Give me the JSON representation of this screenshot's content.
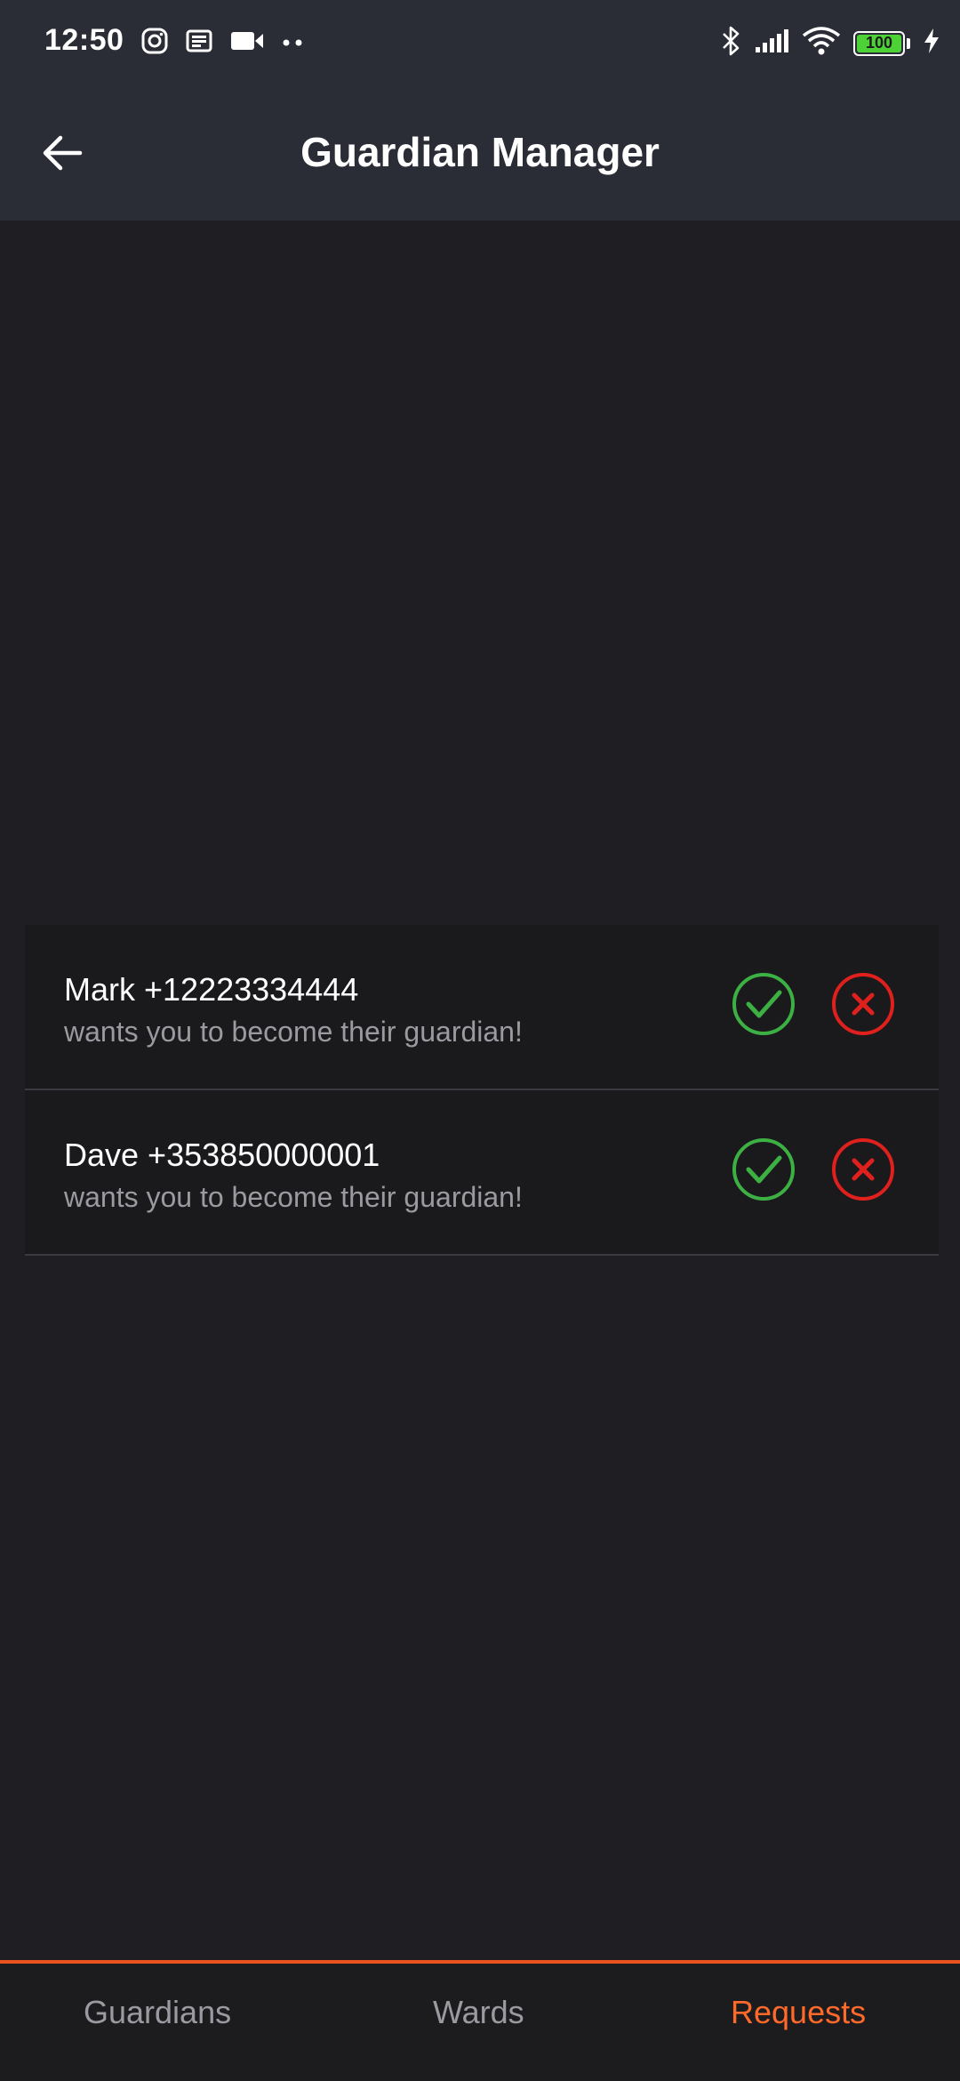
{
  "status_bar": {
    "time": "12:50",
    "left_icons": [
      "instagram-icon",
      "news-icon",
      "video-camera-icon",
      "more-dots-icon"
    ],
    "right_icons": [
      "bluetooth-icon",
      "signal-icon",
      "wifi-icon",
      "battery-icon",
      "charging-icon"
    ],
    "battery_level": "100"
  },
  "app_bar": {
    "title": "Guardian Manager",
    "back_icon": "back-arrow-icon"
  },
  "requests": [
    {
      "name": "Mark +12223334444",
      "message": "wants you to become their guardian!"
    },
    {
      "name": "Dave +353850000001",
      "message": "wants you to become their guardian!"
    }
  ],
  "colors": {
    "accept": "#3cb043",
    "reject": "#e0201c",
    "accent": "#ff6a2b",
    "header_bg": "#2a2c36",
    "page_bg": "#1f1f23"
  },
  "tabs": [
    {
      "label": "Guardians",
      "active": false
    },
    {
      "label": "Wards",
      "active": false
    },
    {
      "label": "Requests",
      "active": true
    }
  ]
}
